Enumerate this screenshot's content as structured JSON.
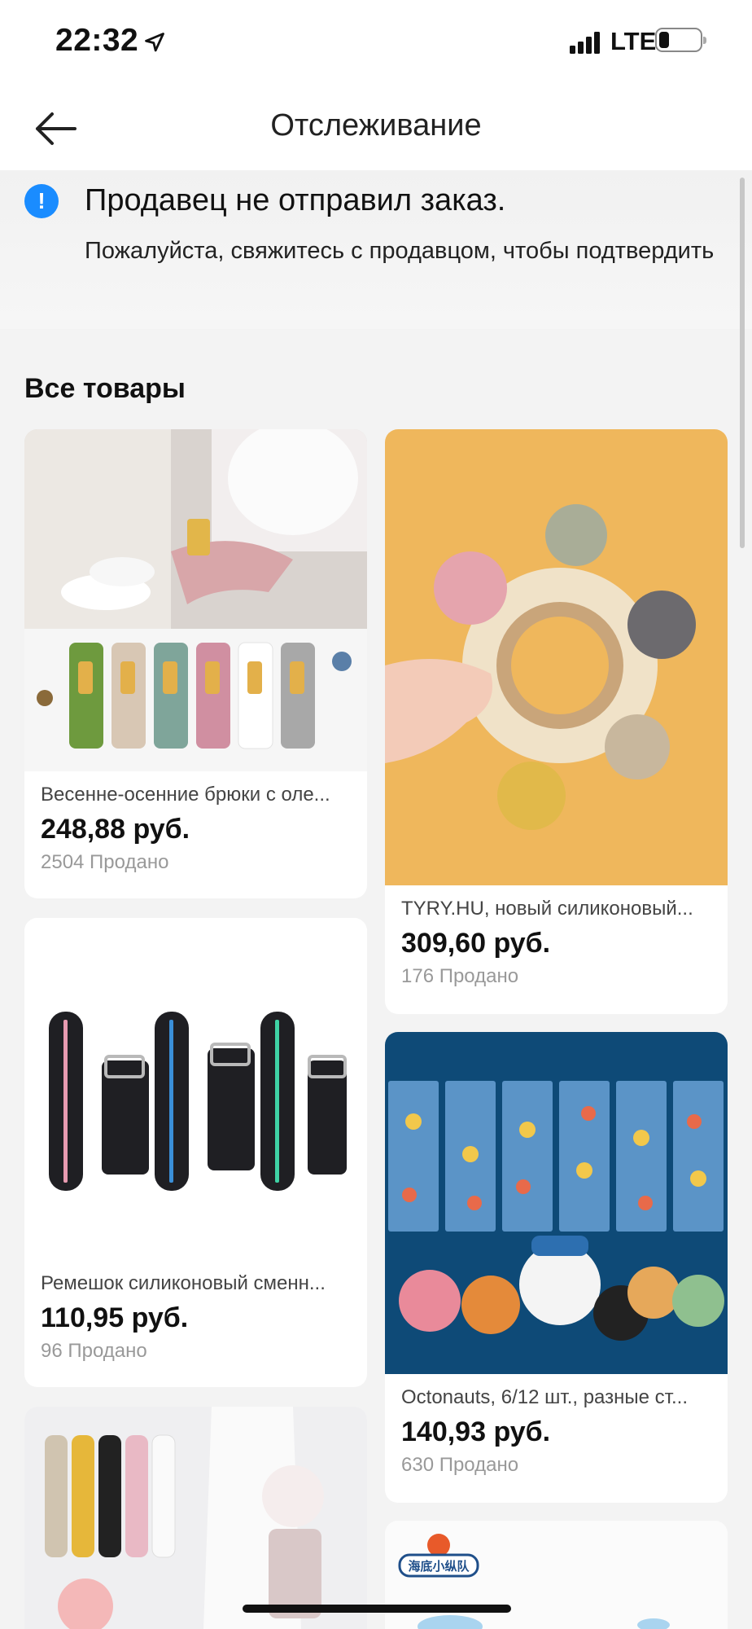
{
  "status_bar": {
    "time": "22:32",
    "network": "LTE",
    "battery_level": 0.2
  },
  "nav": {
    "title": "Отслеживание"
  },
  "banner": {
    "title": "Продавец не отправил заказ.",
    "text": "Пожалуйста, свяжитесь с продавцом, чтобы подтвердить"
  },
  "section": {
    "title": "Все товары"
  },
  "products": [
    {
      "name": "Весенне-осенние брюки с оле...",
      "price": "248,88 руб.",
      "sold": "2504 Продано"
    },
    {
      "name": "TYRY.HU, новый силиконовый...",
      "price": "309,60 руб.",
      "sold": "176 Продано"
    },
    {
      "name": "Ремешок силиконовый сменн...",
      "price": "110,95 руб.",
      "sold": "96 Продано"
    },
    {
      "name": "Octonauts, 6/12 шт., разные ст...",
      "price": "140,93 руб.",
      "sold": "630 Продано"
    },
    {
      "name": "",
      "price": "",
      "sold": ""
    },
    {
      "name": "",
      "price": "",
      "sold": "",
      "logo_text": "海底小纵队"
    }
  ]
}
